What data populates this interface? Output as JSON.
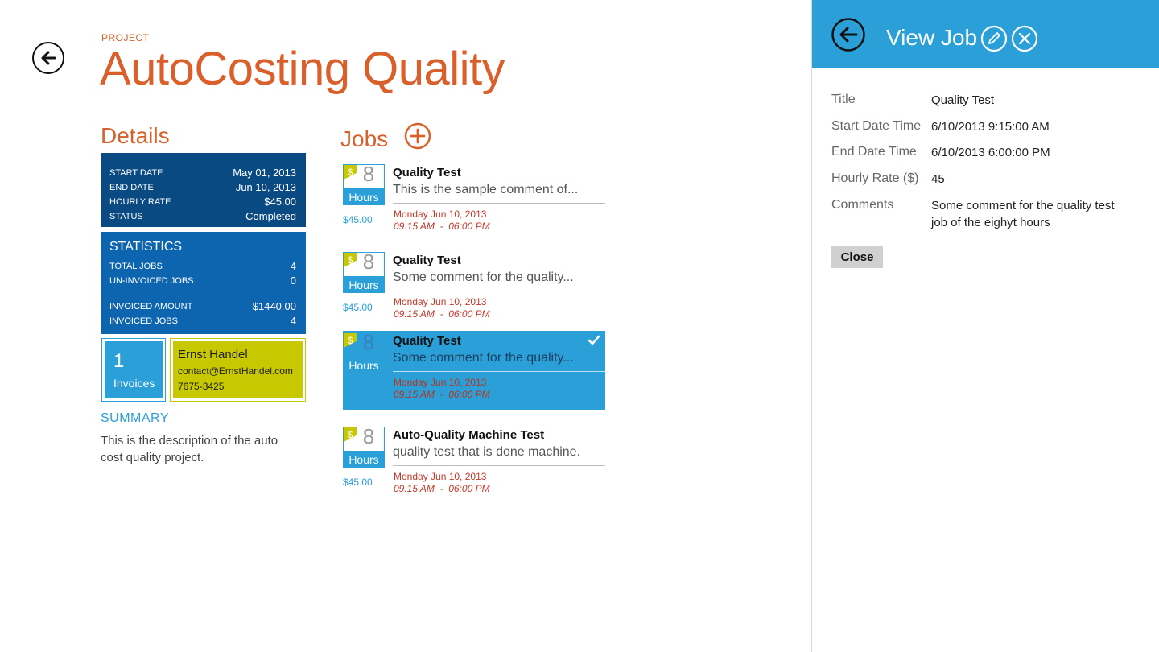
{
  "project": {
    "label": "PROJECT",
    "title": "AutoCosting Quality"
  },
  "details": {
    "title": "Details",
    "rows": [
      {
        "key": "START DATE",
        "value": "May 01, 2013"
      },
      {
        "key": "END DATE",
        "value": "Jun 10, 2013"
      },
      {
        "key": "HOURLY RATE",
        "value": "$45.00"
      },
      {
        "key": "STATUS",
        "value": "Completed"
      }
    ]
  },
  "statistics": {
    "title": "STATISTICS",
    "rows": [
      {
        "key": "TOTAL JOBS",
        "value": "4"
      },
      {
        "key": "UN-INVOICED JOBS",
        "value": "0"
      },
      {
        "key": "INVOICED AMOUNT",
        "value": "$1440.00"
      },
      {
        "key": "INVOICED JOBS",
        "value": "4"
      }
    ]
  },
  "invoices": {
    "count": "1",
    "label": "Invoices"
  },
  "contact": {
    "name": "Ernst Handel",
    "email": "contact@ErnstHandel.com",
    "phone": "7675-3425"
  },
  "summary": {
    "label": "SUMMARY",
    "text": "This is the description of the auto cost quality project."
  },
  "jobs": {
    "title": "Jobs",
    "items": [
      {
        "hours": "8",
        "unit": "Hours",
        "dollar": "$",
        "rate": "$45.00",
        "title": "Quality Test",
        "comment": "This is the sample comment of...",
        "date": "Monday Jun 10, 2013",
        "time": "09:15 AM  -  06:00 PM",
        "selected": false
      },
      {
        "hours": "8",
        "unit": "Hours",
        "dollar": "$",
        "rate": "$45.00",
        "title": "Quality Test",
        "comment": "Some comment for the quality...",
        "date": "Monday Jun 10, 2013",
        "time": "09:15 AM  -  06:00 PM",
        "selected": false
      },
      {
        "hours": "8",
        "unit": "Hours",
        "dollar": "$",
        "rate": "",
        "title": "Quality Test",
        "comment": "Some comment for the quality...",
        "date": "Monday Jun 10, 2013",
        "time": "09:15 AM  -  06:00 PM",
        "selected": true
      },
      {
        "hours": "8",
        "unit": "Hours",
        "dollar": "$",
        "rate": "$45.00",
        "title": "Auto-Quality Machine Test",
        "comment": "quality test that is done machine.",
        "date": "Monday Jun 10, 2013",
        "time": "09:15 AM  -  06:00 PM",
        "selected": false
      }
    ]
  },
  "panel": {
    "title": "View Job",
    "fields": [
      {
        "label": "Title",
        "value": "Quality Test"
      },
      {
        "label": "Start Date Time",
        "value": "6/10/2013 9:15:00 AM"
      },
      {
        "label": "End Date Time",
        "value": "6/10/2013 6:00:00 PM"
      },
      {
        "label": "Hourly Rate ($)",
        "value": "45"
      },
      {
        "label": "Comments",
        "value": "Some comment for the quality test job of the eighyt hours"
      }
    ],
    "close_label": "Close"
  },
  "colors": {
    "accent_orange": "#d9602a",
    "accent_blue": "#2a9fd8",
    "dark_blue": "#0a4a82",
    "mid_blue": "#0d65b0",
    "lime": "#c8c800"
  }
}
